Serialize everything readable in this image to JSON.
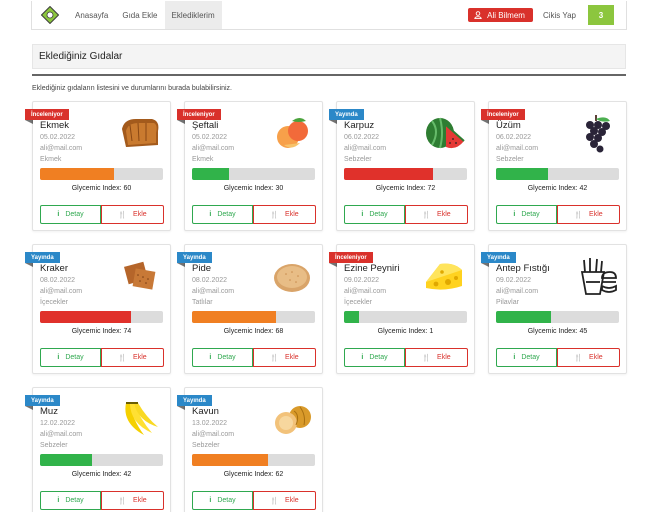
{
  "nav": {
    "items": [
      "Anasayfa",
      "Gıda Ekle",
      "Eklediklerim"
    ],
    "user": "Ali Bilmem",
    "logout": "Cikis Yap",
    "badge": "3"
  },
  "header": {
    "title": "Eklediğiniz Gıdalar",
    "subtitle": "Eklediğiniz gıdaların listesini ve durumlarını burada bulabilirsiniz."
  },
  "labels": {
    "gi_prefix": "Glycemic Index:",
    "detay": "Detay",
    "ekle": "Ekle"
  },
  "colors": {
    "red": "#e0312b",
    "orange": "#f07f22",
    "green": "#31b34a",
    "status_red": "#d9312b",
    "status_blue": "#2b88c8"
  },
  "cards": [
    {
      "status": "İnceleniyor",
      "name": "Ekmek",
      "date": "05.02.2022",
      "email": "ali@mail.com",
      "category": "Ekmek",
      "gi": 60,
      "bar_fraction": 0.6,
      "bar_color": "orange",
      "image": "bread-icon"
    },
    {
      "status": "İnceleniyor",
      "name": "Şeftali",
      "date": "05.02.2022",
      "email": "ali@mail.com",
      "category": "Ekmek",
      "gi": 30,
      "bar_fraction": 0.3,
      "bar_color": "green",
      "image": "peach-icon"
    },
    {
      "status": "Yayında",
      "name": "Karpuz",
      "date": "06.02.2022",
      "email": "ali@mail.com",
      "category": "Sebzeler",
      "gi": 72,
      "bar_fraction": 0.72,
      "bar_color": "red",
      "image": "watermelon-icon"
    },
    {
      "status": "İnceleniyor",
      "name": "Üzüm",
      "date": "06.02.2022",
      "email": "ali@mail.com",
      "category": "Sebzeler",
      "gi": 42,
      "bar_fraction": 0.42,
      "bar_color": "green",
      "image": "grapes-icon"
    },
    {
      "status": "Yayında",
      "name": "Kraker",
      "date": "08.02.2022",
      "email": "ali@mail.com",
      "category": "İçecekler",
      "gi": 74,
      "bar_fraction": 0.74,
      "bar_color": "red",
      "image": "cracker-icon"
    },
    {
      "status": "Yayında",
      "name": "Pide",
      "date": "08.02.2022",
      "email": "ali@mail.com",
      "category": "Tatlılar",
      "gi": 68,
      "bar_fraction": 0.68,
      "bar_color": "orange",
      "image": "pide-bread-icon"
    },
    {
      "status": "İnceleniyor",
      "name": "Ezine Peyniri",
      "date": "09.02.2022",
      "email": "ali@mail.com",
      "category": "İçecekler",
      "gi": 1,
      "bar_fraction": 0.12,
      "bar_color": "green",
      "image": "cheese-icon"
    },
    {
      "status": "Yayında",
      "name": "Antep Fıstığı",
      "date": "09.02.2022",
      "email": "ali@mail.com",
      "category": "Pilavlar",
      "gi": 45,
      "bar_fraction": 0.45,
      "bar_color": "green",
      "image": "fast-food-icon"
    },
    {
      "status": "Yayında",
      "name": "Muz",
      "date": "12.02.2022",
      "email": "ali@mail.com",
      "category": "Sebzeler",
      "gi": 42,
      "bar_fraction": 0.42,
      "bar_color": "green",
      "image": "banana-icon"
    },
    {
      "status": "Yayında",
      "name": "Kavun",
      "date": "13.02.2022",
      "email": "ali@mail.com",
      "category": "Sebzeler",
      "gi": 62,
      "bar_fraction": 0.62,
      "bar_color": "orange",
      "image": "melon-icon"
    }
  ]
}
